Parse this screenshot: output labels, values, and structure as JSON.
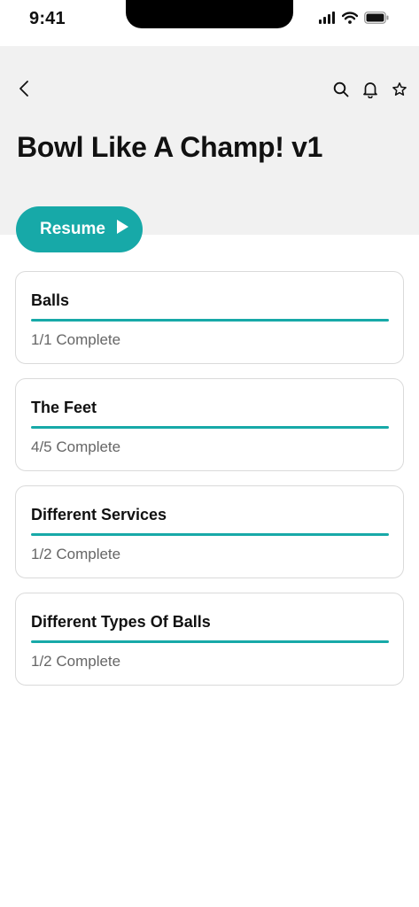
{
  "status_bar": {
    "time": "9:41"
  },
  "header": {
    "title": "Bowl Like A Champ! v1"
  },
  "resume": {
    "label": "Resume"
  },
  "colors": {
    "accent": "#17a9a8",
    "header_bg": "#f1f1f1",
    "muted_text": "#666666"
  },
  "icons": [
    "back-chevron-icon",
    "search-icon",
    "bell-icon",
    "star-icon",
    "play-icon"
  ],
  "modules": [
    {
      "title": "Balls",
      "status": "1/1 Complete",
      "progress": 1.0
    },
    {
      "title": "The Feet",
      "status": "4/5 Complete",
      "progress": 1.0
    },
    {
      "title": "Different Services",
      "status": "1/2 Complete",
      "progress": 1.0
    },
    {
      "title": "Different Types Of Balls",
      "status": "1/2 Complete",
      "progress": 1.0
    }
  ]
}
